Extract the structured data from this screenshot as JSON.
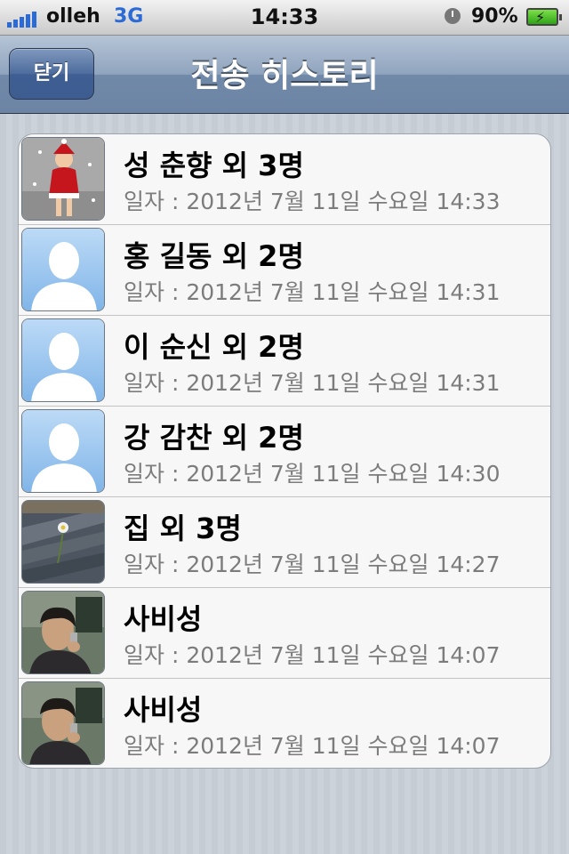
{
  "status_bar": {
    "carrier": "olleh",
    "network": "3G",
    "time": "14:33",
    "battery_percent": "90%",
    "signal_color": "#2c6bd6"
  },
  "nav": {
    "close_label": "닫기",
    "title": "전송 히스토리"
  },
  "history": [
    {
      "name": "성 춘향 외 3명",
      "date": "일자 : 2012년 7월 11일 수요일 14:33",
      "avatar": "santa-photo"
    },
    {
      "name": "홍 길동 외 2명",
      "date": "일자 : 2012년 7월 11일 수요일 14:31",
      "avatar": "default-contact-icon"
    },
    {
      "name": "이 순신 외 2명",
      "date": "일자 : 2012년 7월 11일 수요일 14:31",
      "avatar": "default-contact-icon"
    },
    {
      "name": "강 감찬 외 2명",
      "date": "일자 : 2012년 7월 11일 수요일 14:30",
      "avatar": "default-contact-icon"
    },
    {
      "name": "집 외 3명",
      "date": "일자 : 2012년 7월 11일 수요일 14:27",
      "avatar": "flower-photo"
    },
    {
      "name": "사비성",
      "date": "일자 : 2012년 7월 11일 수요일 14:07",
      "avatar": "person-phone-photo"
    },
    {
      "name": "사비성",
      "date": "일자 : 2012년 7월 11일 수요일 14:07",
      "avatar": "person-phone-photo"
    }
  ]
}
